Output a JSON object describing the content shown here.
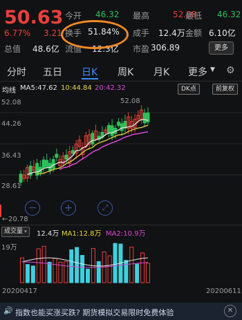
{
  "quote": {
    "price": "50.63",
    "change_pct": "6.77%",
    "change": "3.21",
    "open_label": "今开",
    "open": "46.32",
    "high_label": "最高",
    "high": "52.08",
    "low_label": "最低",
    "low": "46.32",
    "turnover_label": "换手",
    "turnover": "51.84%",
    "volume_label": "成手",
    "volume": "12.4万",
    "amount_label": "金额",
    "amount": "6.10亿",
    "total_value_label": "总值",
    "total_value": "48.6亿",
    "float_value_label": "流值",
    "float_value": "12.3亿",
    "pe_label": "市盈",
    "pe": "306.89",
    "more_label": "更多"
  },
  "tabs": [
    "分时",
    "五日",
    "日K",
    "周K",
    "月K",
    "更多"
  ],
  "active_tab": "日K",
  "ma": {
    "label": "均线",
    "ma5_label": "MA5:47.62",
    "ma10_label": "10:44.84",
    "ma20_label": "20:42.32",
    "dk_button": "DK点",
    "adjust_button": "前复权",
    "colors": {
      "ma5": "#e6e6e6",
      "ma10": "#e8d44a",
      "ma20": "#d848d8"
    }
  },
  "price_axis": {
    "labels": [
      "52.08",
      "44.26",
      "36.43",
      "28.61"
    ],
    "peak_annotation": "52.08",
    "low_annotation": "20.78",
    "low_arrow": "←"
  },
  "volume": {
    "button": "成交量",
    "vol_label": "12.4万",
    "ma1_label": "MA1:12.8万",
    "ma2_label": "MA2:10.9万",
    "axis_top": "19万",
    "colors": {
      "bar": "#3fd0e0",
      "up": "#e8403a",
      "ma1": "#e6e6e6",
      "ma2": "#d848d8"
    }
  },
  "dates": {
    "start": "20200417",
    "end": "20200611"
  },
  "banner": {
    "text": "指数也能买涨买跌? 期货模拟交易限时免费体验"
  },
  "colors": {
    "up": "#e8403a",
    "down": "#2fbf5a",
    "accent": "#3b8cff",
    "highlight": "#f08a26"
  }
}
